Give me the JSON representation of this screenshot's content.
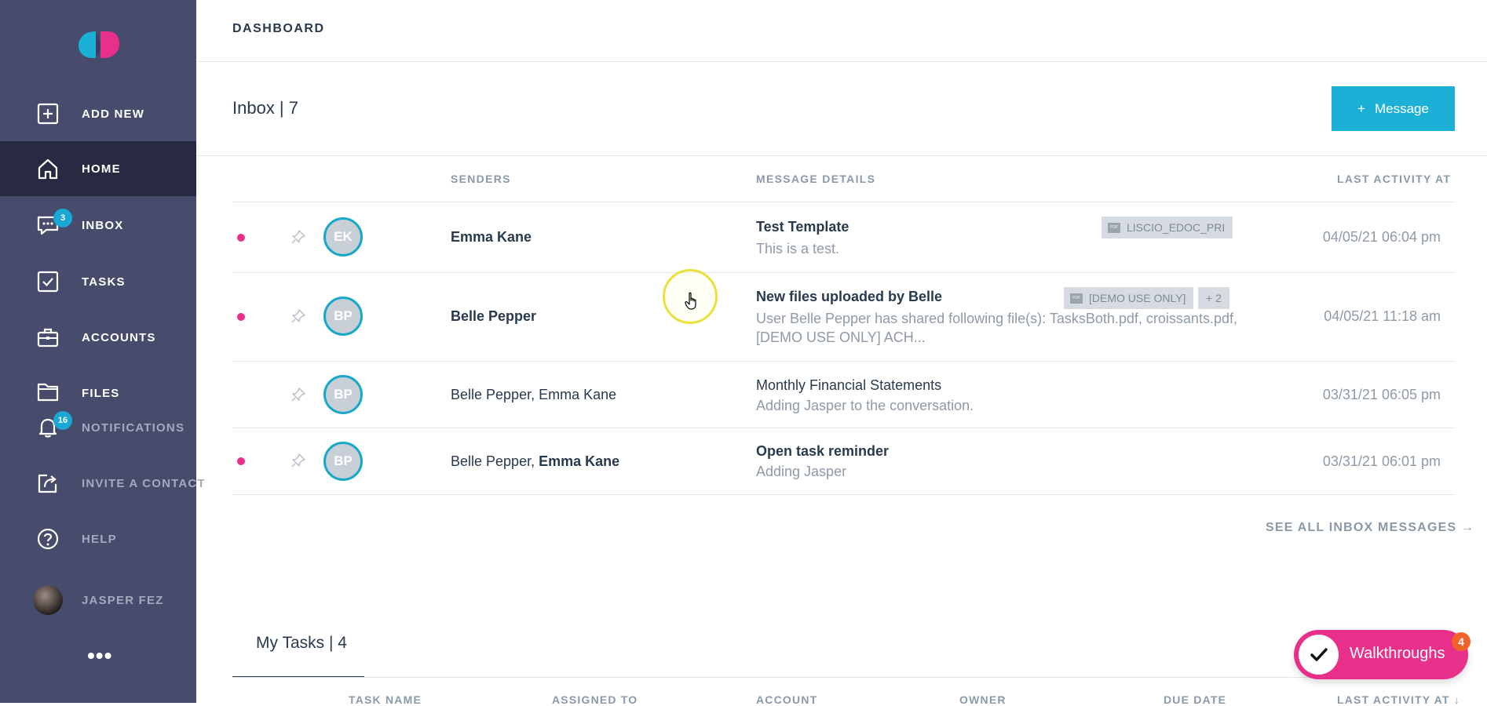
{
  "sidebar": {
    "items": [
      {
        "label": "ADD NEW",
        "icon": "plus-square-icon"
      },
      {
        "label": "HOME",
        "icon": "home-icon"
      },
      {
        "label": "INBOX",
        "icon": "chat-icon",
        "badge": "3"
      },
      {
        "label": "TASKS",
        "icon": "check-square-icon"
      },
      {
        "label": "ACCOUNTS",
        "icon": "briefcase-icon"
      },
      {
        "label": "FILES",
        "icon": "folder-icon"
      },
      {
        "label": "NOTIFICATIONS",
        "icon": "bell-icon",
        "badge": "16"
      },
      {
        "label": "INVITE A CONTACT",
        "icon": "share-icon"
      },
      {
        "label": "HELP",
        "icon": "help-icon"
      }
    ],
    "user": {
      "name": "JASPER FEZ"
    },
    "more": "•••"
  },
  "header": {
    "title": "DASHBOARD"
  },
  "inbox": {
    "title": "Inbox | 7",
    "new_button": {
      "plus": "+",
      "label": "Message"
    },
    "columns": {
      "senders": "SENDERS",
      "details": "MESSAGE DETAILS",
      "last_activity": "LAST ACTIVITY AT"
    },
    "rows": [
      {
        "unread": true,
        "initials": "EK",
        "senders_plain": "",
        "senders_bold": "Emma Kane",
        "subject": "Test Template",
        "preview": "This is a test.",
        "attachments": [
          "LISCIO_EDOC_PRI"
        ],
        "extra": "",
        "date": "04/05/21 06:04 pm"
      },
      {
        "unread": true,
        "initials": "BP",
        "senders_plain": "",
        "senders_bold": "Belle Pepper",
        "subject": "New files uploaded by Belle",
        "preview": "User Belle Pepper has shared following file(s): TasksBoth.pdf, croissants.pdf, [DEMO USE ONLY] ACH...",
        "attachments": [
          "[DEMO USE ONLY]"
        ],
        "extra": "+ 2",
        "date": "04/05/21 11:18 am"
      },
      {
        "unread": false,
        "initials": "BP",
        "senders_plain": "Belle Pepper, Emma Kane",
        "senders_bold": "",
        "subject": "Monthly Financial Statements",
        "preview": "Adding Jasper to the conversation.",
        "attachments": [],
        "extra": "",
        "date": "03/31/21 06:05 pm"
      },
      {
        "unread": true,
        "initials": "BP",
        "senders_plain": "Belle Pepper, ",
        "senders_bold": "Emma Kane",
        "subject": "Open task reminder",
        "preview": "Adding Jasper",
        "attachments": [],
        "extra": "",
        "date": "03/31/21 06:01 pm"
      }
    ],
    "see_all": "SEE ALL INBOX MESSAGES →"
  },
  "tasks": {
    "title": "My Tasks | 4",
    "columns": [
      "TASK NAME",
      "ASSIGNED TO",
      "ACCOUNT",
      "OWNER",
      "DUE DATE",
      "LAST ACTIVITY AT ↓"
    ]
  },
  "walkthroughs": {
    "label": "Walkthroughs",
    "badge": "4"
  },
  "colors": {
    "sidebar": "#474b6c",
    "sidebar_active": "#282a42",
    "accent": "#1bb1d6",
    "unread_dot": "#e8308a",
    "walkthroughs": "#e8308a"
  }
}
